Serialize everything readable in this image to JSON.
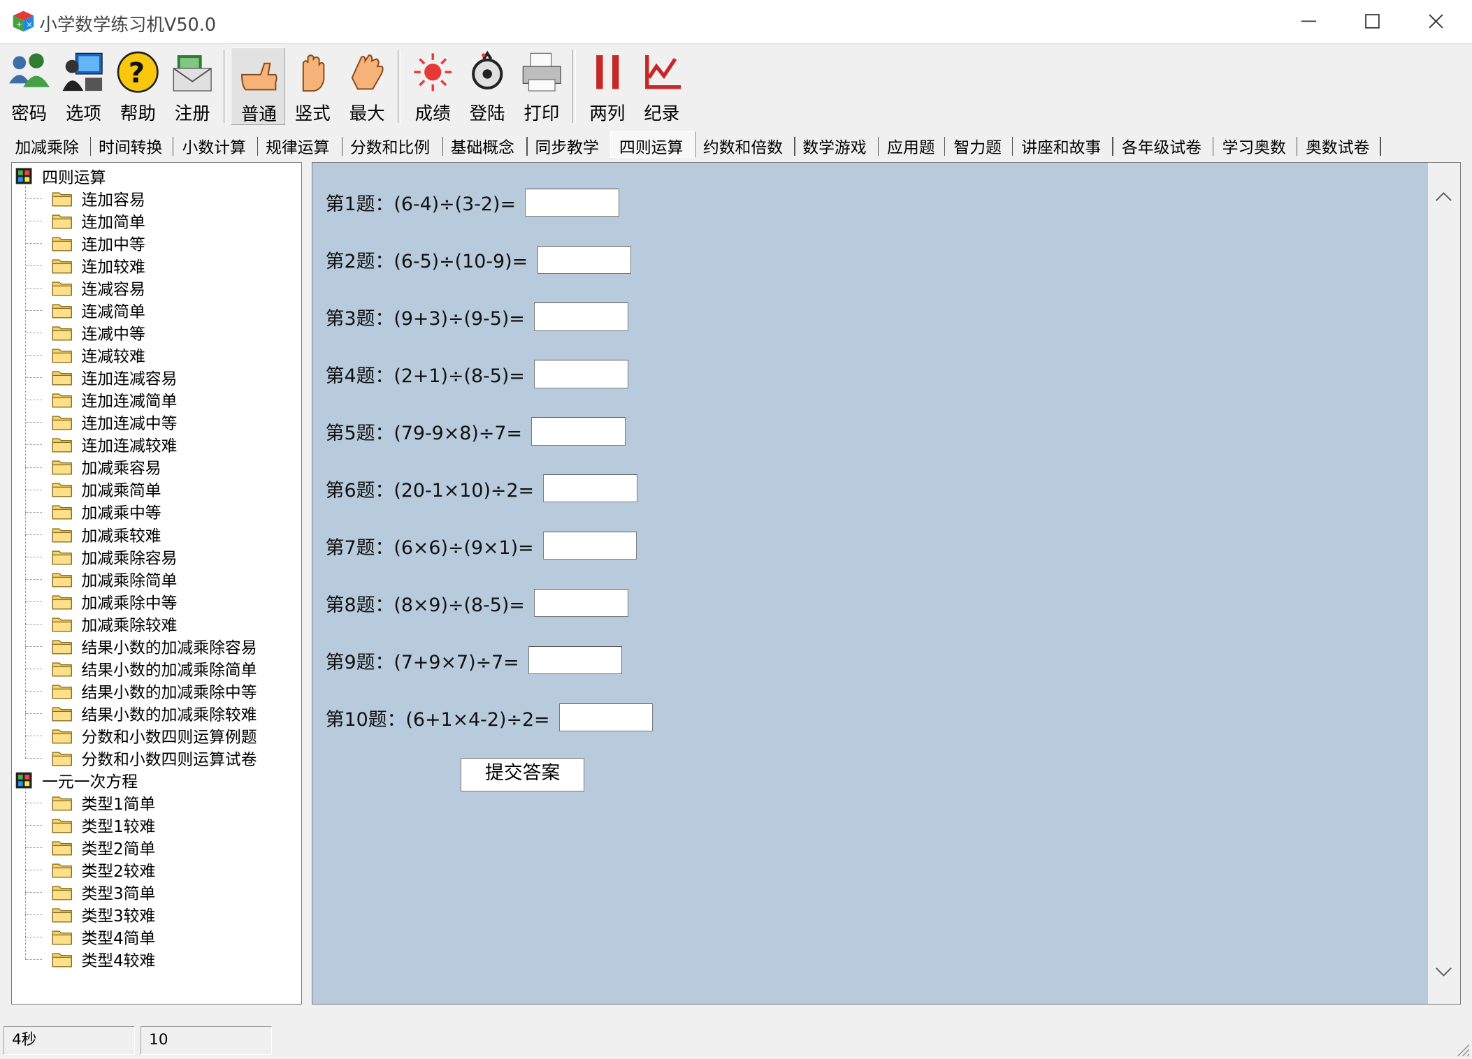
{
  "window": {
    "title": "小学数学练习机V50.0"
  },
  "toolbar": {
    "buttons": [
      {
        "label": "密码",
        "icon": "users-icon"
      },
      {
        "label": "选项",
        "icon": "options-icon"
      },
      {
        "label": "帮助",
        "icon": "help-icon"
      },
      {
        "label": "注册",
        "icon": "register-mail-icon"
      },
      {
        "label": "普通",
        "icon": "hand-point-icon",
        "pressed": true
      },
      {
        "label": "竖式",
        "icon": "hand-raise-icon"
      },
      {
        "label": "最大",
        "icon": "hand-open-icon"
      },
      {
        "label": "成绩",
        "icon": "score-icon"
      },
      {
        "label": "登陆",
        "icon": "login-icon"
      },
      {
        "label": "打印",
        "icon": "printer-icon"
      },
      {
        "label": "两列",
        "icon": "two-columns-icon"
      },
      {
        "label": "纪录",
        "icon": "chart-record-icon"
      }
    ]
  },
  "tabs": {
    "items": [
      "加减乘除",
      "时间转换",
      "小数计算",
      "规律运算",
      "分数和比例",
      "基础概念",
      "同步教学",
      "四则运算",
      "约数和倍数",
      "数学游戏",
      "应用题",
      "智力题",
      "讲座和故事",
      "各年级试卷",
      "学习奥数",
      "奥数试卷"
    ],
    "active": "四则运算"
  },
  "tree": {
    "groups": [
      {
        "label": "四则运算",
        "children": [
          "连加容易",
          "连加简单",
          "连加中等",
          "连加较难",
          "连减容易",
          "连减简单",
          "连减中等",
          "连减较难",
          "连加连减容易",
          "连加连减简单",
          "连加连减中等",
          "连加连减较难",
          "加减乘容易",
          "加减乘简单",
          "加减乘中等",
          "加减乘较难",
          "加减乘除容易",
          "加减乘除简单",
          "加减乘除中等",
          "加减乘除较难",
          "结果小数的加减乘除容易",
          "结果小数的加减乘除简单",
          "结果小数的加减乘除中等",
          "结果小数的加减乘除较难",
          "分数和小数四则运算例题",
          "分数和小数四则运算试卷"
        ]
      },
      {
        "label": "一元一次方程",
        "children": [
          "类型1简单",
          "类型1较难",
          "类型2简单",
          "类型2较难",
          "类型3简单",
          "类型3较难",
          "类型4简单",
          "类型4较难"
        ]
      }
    ]
  },
  "quiz": {
    "questions": [
      "第1题：(6-4)÷(3-2)=",
      "第2题：(6-5)÷(10-9)=",
      "第3题：(9+3)÷(9-5)=",
      "第4题：(2+1)÷(8-5)=",
      "第5题：(79-9×8)÷7=",
      "第6题：(20-1×10)÷2=",
      "第7题：(6×6)÷(9×1)=",
      "第8题：(8×9)÷(8-5)=",
      "第9题：(7+9×7)÷7=",
      "第10题：(6+1×4-2)÷2="
    ],
    "submit_label": "提交答案"
  },
  "status": {
    "timer": "4秒",
    "count": "10"
  }
}
